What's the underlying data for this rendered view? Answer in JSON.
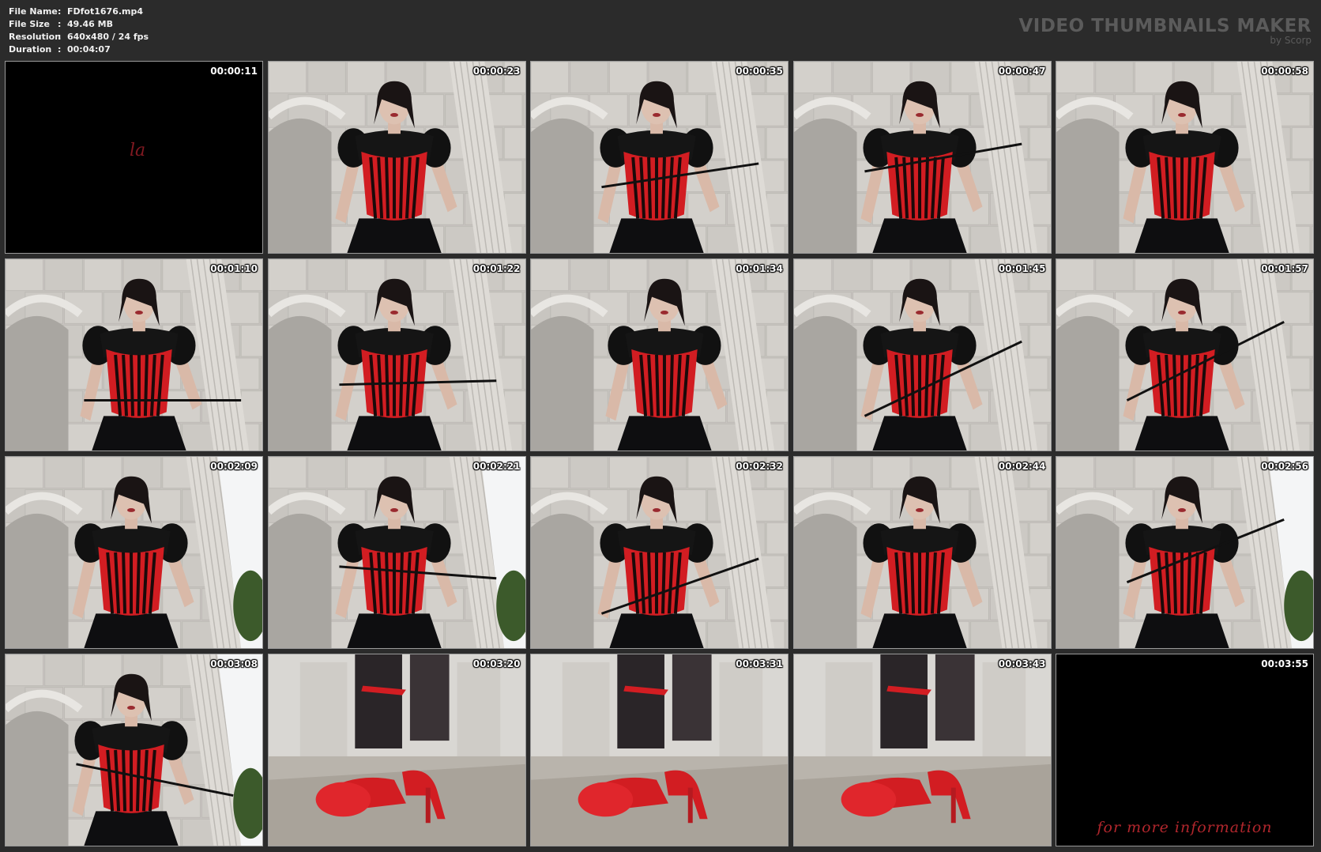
{
  "file_info": {
    "rows": [
      {
        "key": "File Name",
        "value": "FDfot1676.mp4"
      },
      {
        "key": "File Size",
        "value": "49.46 MB"
      },
      {
        "key": "Resolution",
        "value": "640x480 / 24 fps"
      },
      {
        "key": "Duration",
        "value": "00:04:07"
      }
    ]
  },
  "brand": {
    "title": "VIDEO THUMBNAILS MAKER",
    "subtitle": "by Scorp"
  },
  "thumbnails": [
    {
      "time": "00:00:11",
      "scene": "black-intro",
      "overlay": "la"
    },
    {
      "time": "00:00:23",
      "scene": "woman-wide"
    },
    {
      "time": "00:00:35",
      "scene": "woman-close"
    },
    {
      "time": "00:00:47",
      "scene": "woman-close"
    },
    {
      "time": "00:00:58",
      "scene": "woman-close"
    },
    {
      "time": "00:01:10",
      "scene": "woman-side"
    },
    {
      "time": "00:01:22",
      "scene": "woman-close"
    },
    {
      "time": "00:01:34",
      "scene": "woman-side"
    },
    {
      "time": "00:01:45",
      "scene": "woman-close"
    },
    {
      "time": "00:01:57",
      "scene": "woman-wide"
    },
    {
      "time": "00:02:09",
      "scene": "woman-sky"
    },
    {
      "time": "00:02:21",
      "scene": "woman-sky"
    },
    {
      "time": "00:02:32",
      "scene": "woman-wide"
    },
    {
      "time": "00:02:44",
      "scene": "woman-wide"
    },
    {
      "time": "00:02:56",
      "scene": "woman-sky"
    },
    {
      "time": "00:03:08",
      "scene": "woman-sky"
    },
    {
      "time": "00:03:20",
      "scene": "shoes"
    },
    {
      "time": "00:03:31",
      "scene": "shoes"
    },
    {
      "time": "00:03:43",
      "scene": "shoes"
    },
    {
      "time": "00:03:55",
      "scene": "black-outro",
      "overlay": "for more information"
    }
  ],
  "colors": {
    "background": "#2b2b2b",
    "corset_red": "#d21d22",
    "marble": "#c9c6c1",
    "brand_gray": "#5b5b5b"
  }
}
